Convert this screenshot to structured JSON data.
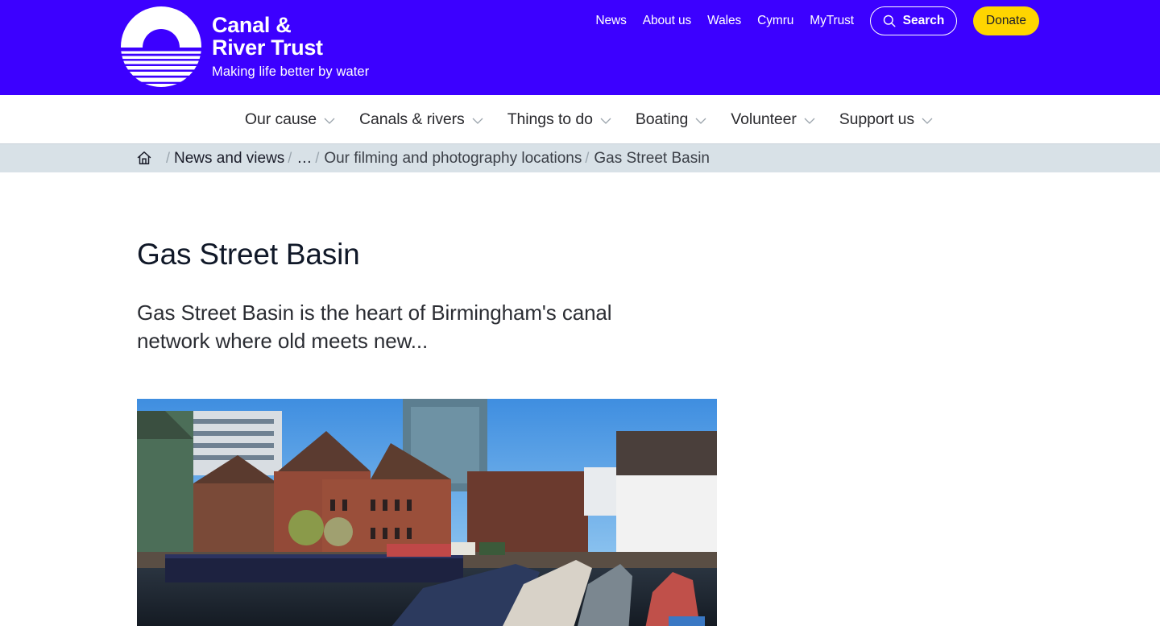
{
  "header": {
    "brand_line1": "Canal &",
    "brand_line2": "River Trust",
    "tagline": "Making life better by water",
    "brand_color": "#3c00ff",
    "utility_links": [
      {
        "label": "News"
      },
      {
        "label": "About us"
      },
      {
        "label": "Wales"
      },
      {
        "label": "Cymru"
      },
      {
        "label": "MyTrust"
      }
    ],
    "search_label": "Search",
    "donate_label": "Donate",
    "donate_color": "#ffd500"
  },
  "main_nav": {
    "items": [
      {
        "label": "Our cause",
        "icon": "chevron-down-icon"
      },
      {
        "label": "Canals & rivers",
        "icon": "chevron-down-icon"
      },
      {
        "label": "Things to do",
        "icon": "chevron-down-icon"
      },
      {
        "label": "Boating",
        "icon": "chevron-down-icon"
      },
      {
        "label": "Volunteer",
        "icon": "chevron-down-icon"
      },
      {
        "label": "Support us",
        "icon": "chevron-down-icon"
      }
    ]
  },
  "breadcrumb": {
    "home_icon": "home-icon",
    "separator": "/",
    "items": [
      {
        "label": "News and views"
      },
      {
        "label": "…"
      },
      {
        "label": "Our filming and photography locations"
      }
    ],
    "current": "Gas Street Basin"
  },
  "page": {
    "title": "Gas Street Basin",
    "intro": "Gas Street Basin is the heart of Birmingham's canal network where old meets new...",
    "hero_image_alt": "Narrowboats moored at Gas Street Basin, Birmingham, with brick warehouses and modern buildings"
  }
}
